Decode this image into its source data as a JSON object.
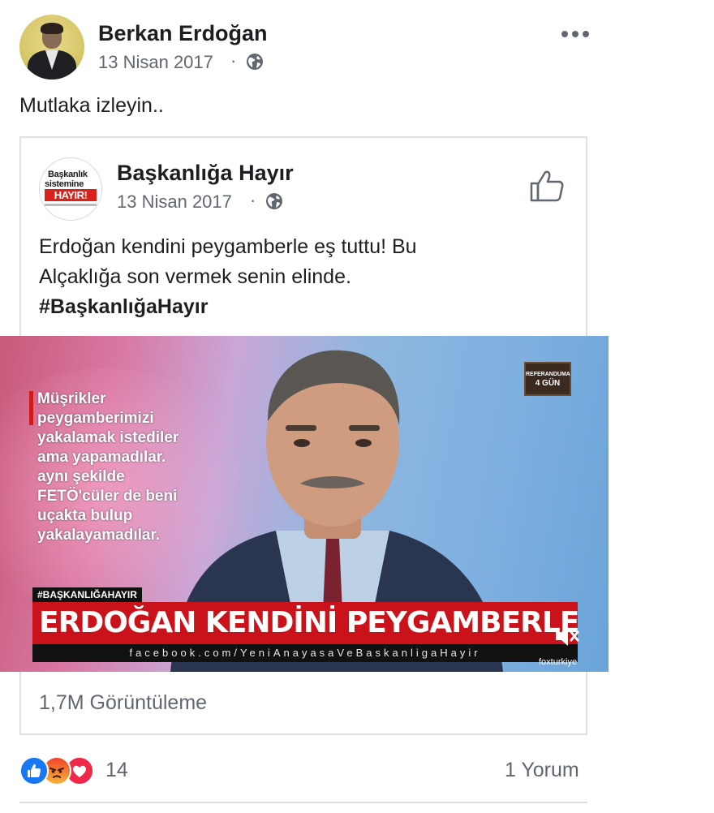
{
  "post": {
    "author": "Berkan Erdoğan",
    "date": "13 Nisan 2017",
    "separator": "·",
    "text": "Mutlaka izleyin.."
  },
  "shared": {
    "page_name": "Başkanlığa Hayır",
    "date": "13 Nisan 2017",
    "separator": "·",
    "logo": {
      "line1": "Başkanlık",
      "line2": "sistemine",
      "line3": "HAYIR!"
    },
    "text_line1": "Erdoğan kendini peygamberle eş tuttu! Bu",
    "text_line2": "Alçaklığa son vermek senin elinde.",
    "hashtag": "#BaşkanlığaHayır",
    "views": "1,7M Görüntüleme"
  },
  "video": {
    "quote_lines": [
      "Müşrikler",
      "peygamberimizi",
      "yakalamak istediler",
      "ama yapamadılar.",
      "aynı şekilde",
      "FETÖ'cüler de beni",
      "uçakta bulup",
      "yakalayamadılar."
    ],
    "badge_line1": "REFERANDUMA",
    "badge_line2": "4 GÜN",
    "hashtag_label": "#BAŞKANLIĞAHAYIR",
    "banner": "ERDOĞAN KENDİNİ PEYGAMBERLE EŞ TUTTU",
    "url": "facebook.com/YeniAnayasaVeBaskanligaHayir",
    "watermark": "foxturkiye"
  },
  "footer": {
    "reaction_count": "14",
    "comments": "1 Yorum"
  },
  "icons": [
    "globe-icon",
    "more-options-icon",
    "like-outline-icon",
    "mute-icon",
    "like-reaction-icon",
    "angry-reaction-icon",
    "love-reaction-icon"
  ],
  "colors": {
    "text_primary": "#1c1e21",
    "text_secondary": "#606770",
    "border": "#dddfe2",
    "like_blue": "#1877f2",
    "love_red": "#f02849",
    "banner_red": "#c9121a"
  }
}
